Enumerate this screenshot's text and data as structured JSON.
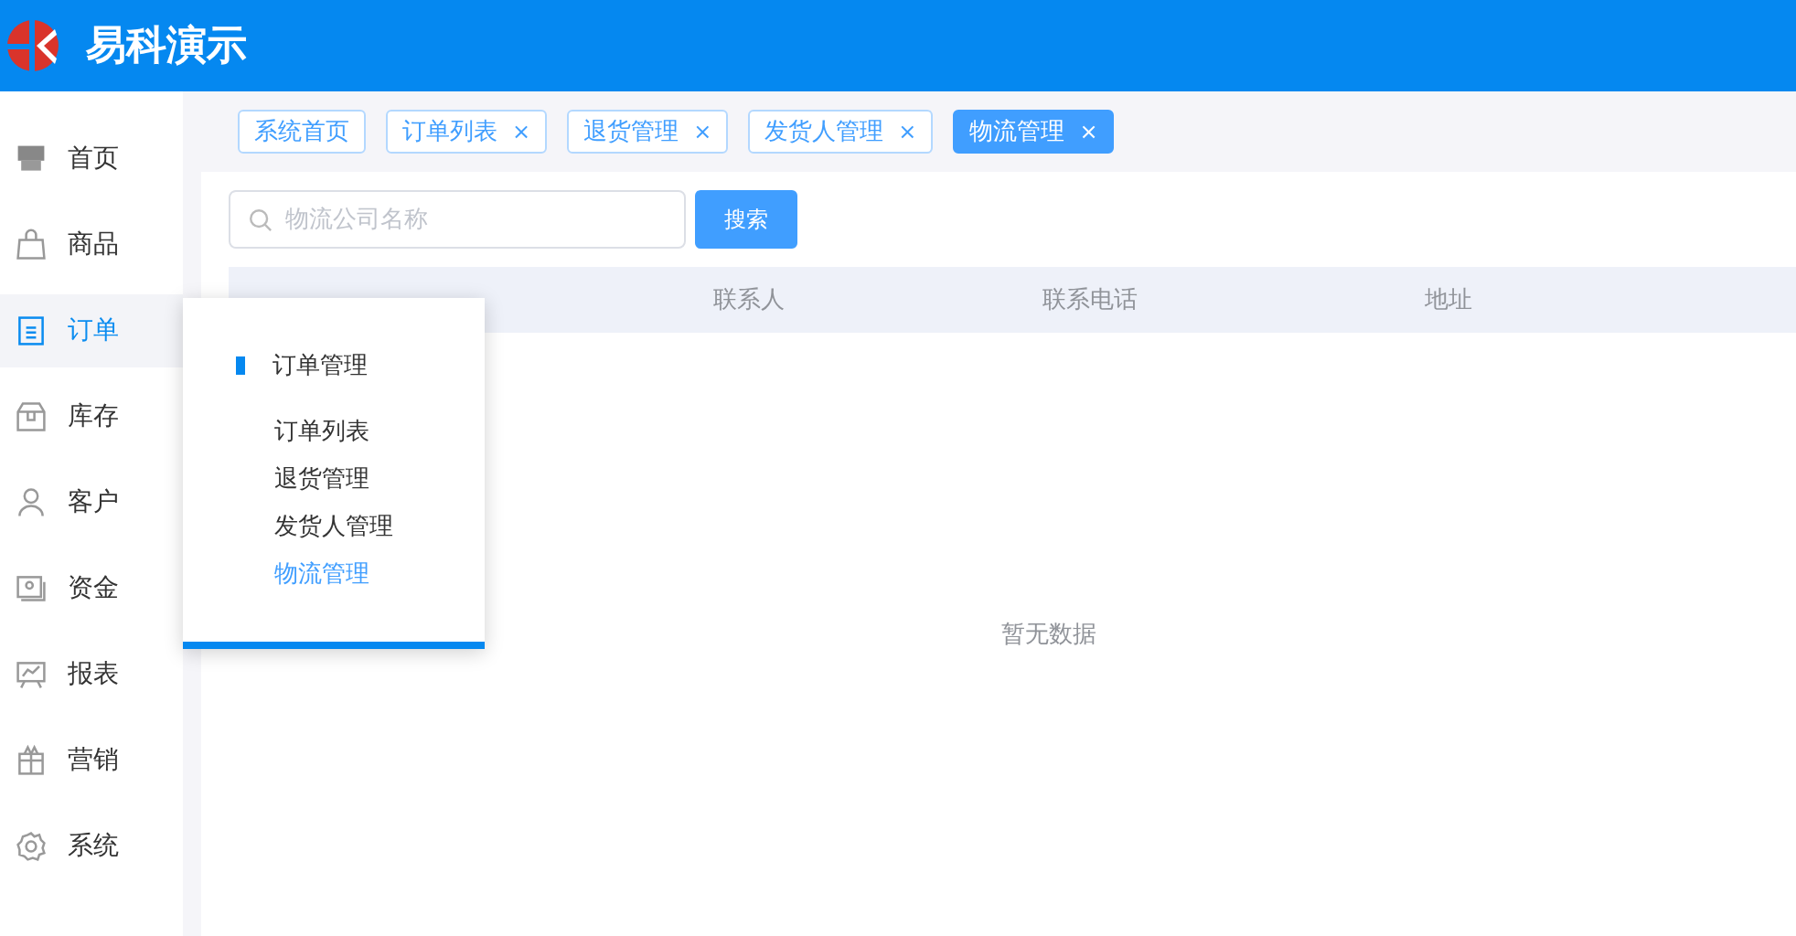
{
  "header": {
    "title": "易科演示"
  },
  "sidebar": {
    "items": [
      {
        "label": "首页",
        "selected": false
      },
      {
        "label": "商品",
        "selected": false
      },
      {
        "label": "订单",
        "selected": true
      },
      {
        "label": "库存",
        "selected": false
      },
      {
        "label": "客户",
        "selected": false
      },
      {
        "label": "资金",
        "selected": false
      },
      {
        "label": "报表",
        "selected": false
      },
      {
        "label": "营销",
        "selected": false
      },
      {
        "label": "系统",
        "selected": false
      }
    ]
  },
  "tabs": [
    {
      "label": "系统首页",
      "selected": false,
      "closable": false
    },
    {
      "label": "订单列表",
      "selected": false,
      "closable": true
    },
    {
      "label": "退货管理",
      "selected": false,
      "closable": true
    },
    {
      "label": "发货人管理",
      "selected": false,
      "closable": true
    },
    {
      "label": "物流管理",
      "selected": true,
      "closable": true
    }
  ],
  "close_glyph": "×",
  "search": {
    "placeholder": "物流公司名称"
  },
  "search_button": "搜索",
  "table": {
    "columns": [
      "联系人",
      "联系电话",
      "地址"
    ],
    "empty_text": "暂无数据"
  },
  "submenu": {
    "title": "订单管理",
    "items": [
      {
        "label": "订单列表",
        "selected": false
      },
      {
        "label": "退货管理",
        "selected": false
      },
      {
        "label": "发货人管理",
        "selected": false
      },
      {
        "label": "物流管理",
        "selected": true
      }
    ]
  }
}
